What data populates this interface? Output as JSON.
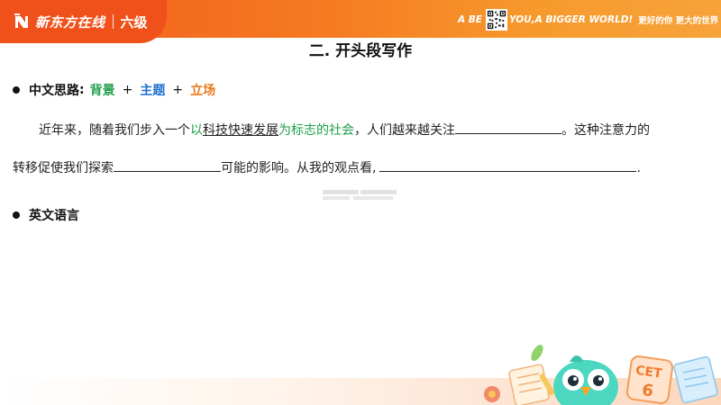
{
  "header": {
    "brand_name": "新东方在线",
    "level": "六级",
    "slogan_left": "A BE",
    "slogan_right": "YOU,A BIGGER WORLD!",
    "slogan_cn": "更好的你 更大的世界",
    "logo_icon": "new-oriental-logo-icon",
    "qr_icon": "qr-code-icon"
  },
  "section": {
    "title": "二. 开头段写作"
  },
  "chinese_approach": {
    "label": "中文思路",
    "colon": ":",
    "background": "背景",
    "theme": "主题",
    "position": "立场",
    "plus": "+"
  },
  "paragraph": {
    "line1_a": "近年来，随着我们步入一个",
    "line1_b": "以",
    "line1_c": "科技快速发展",
    "line1_d": "为标志的社会",
    "line1_e": "，人们越来越关注",
    "line1_f": "。这种注意力的",
    "line2_a": "转移促使我们探索",
    "line2_b": "可能的影响。从我的观点看,",
    "line2_c": "."
  },
  "english_language": {
    "label": "英文语言"
  },
  "decor": {
    "mascot": "parrot-mascot-icon",
    "badge_text": "CET",
    "badge_number": "6"
  },
  "colors": {
    "brand_orange": "#f0511a",
    "keyword_green": "#1e9e4a",
    "keyword_blue": "#1f6fd0",
    "keyword_orange": "#ea7a1c"
  }
}
